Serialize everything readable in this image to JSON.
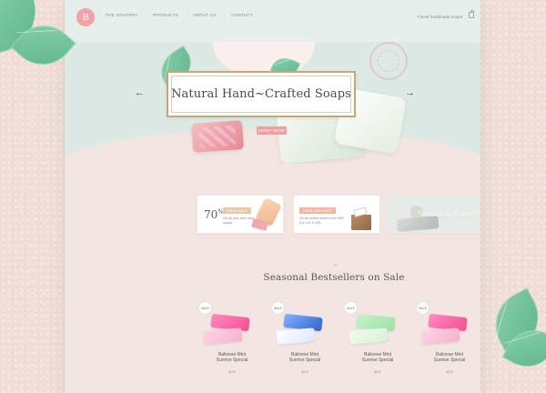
{
  "brand": {
    "logo": "B",
    "accent_color": "#f3a2a6"
  },
  "navigation": {
    "items": [
      "THE SOAPERY",
      "PRODUCTS",
      "ABOUT US",
      "CONTACT"
    ]
  },
  "header": {
    "cart_text": "Finest handmade soaps"
  },
  "hero": {
    "title": "Natural Hand~Crafted Soaps",
    "button_label": "SHOP NOW",
    "left_arrow": "←",
    "right_arrow": "→"
  },
  "promos": [
    {
      "big_value": "70",
      "big_unit": "%",
      "label": "FINAL SALE",
      "description": "On all pine and mint soaps"
    },
    {
      "label": "FREE DELIVERY",
      "description": "On all online orders over $50 (CL UK & US)"
    },
    {
      "label": "Seasonal Sales!"
    }
  ],
  "section": {
    "tilde": "~",
    "title": "Seasonal Bestsellers on Sale"
  },
  "products": [
    {
      "badge": "SALE",
      "name_line_1": "Balinese Mint",
      "name_line_2": "Sunrise Special",
      "price": "$2/5",
      "bar_color": "#f04f90",
      "bar_color_2": "#f8b2cd"
    },
    {
      "badge": "SALE",
      "name_line_1": "Balinese Mint",
      "name_line_2": "Sunrise Special",
      "price": "$2/5",
      "bar_color": "#2e63c8",
      "bar_color_2": "#f4f4f4"
    },
    {
      "badge": "SALE",
      "name_line_1": "Balinese Mint",
      "name_line_2": "Sunrise Special",
      "price": "$2/5",
      "bar_color": "#9fe2a3",
      "bar_color_2": "#d7f2d7"
    },
    {
      "badge": "SALE",
      "name_line_1": "Balinese Mint",
      "name_line_2": "Sunrise Special",
      "price": "$2/5",
      "bar_color": "#f04f90",
      "bar_color_2": "#f8b2cd"
    }
  ]
}
